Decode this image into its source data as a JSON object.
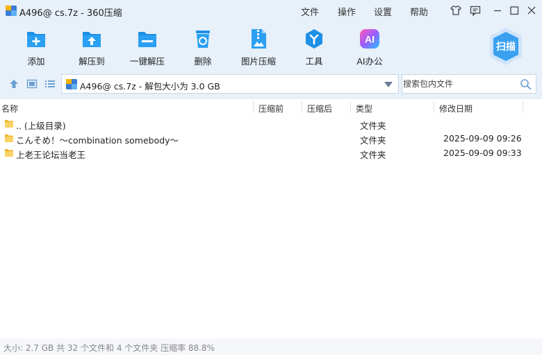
{
  "window": {
    "title": "A496@ cs.7z - 360压缩",
    "menus": [
      "文件",
      "操作",
      "设置",
      "帮助"
    ]
  },
  "toolbar": {
    "items": [
      {
        "label": "添加",
        "icon": "add-folder-icon"
      },
      {
        "label": "解压到",
        "icon": "extract-to-icon"
      },
      {
        "label": "一键解压",
        "icon": "one-click-extract-icon"
      },
      {
        "label": "删除",
        "icon": "recycle-bin-icon"
      },
      {
        "label": "图片压缩",
        "icon": "image-compress-icon"
      },
      {
        "label": "工具",
        "icon": "tools-icon"
      },
      {
        "label": "AI办公",
        "icon": "ai-office-icon"
      }
    ],
    "scan_label": "扫描"
  },
  "nav": {
    "path": "A496@ cs.7z - 解包大小为 3.0 GB",
    "search_placeholder": "搜索包内文件"
  },
  "columns": {
    "name": "名称",
    "packed": "压缩前",
    "compressed": "压缩后",
    "type": "类型",
    "modified": "修改日期"
  },
  "files": [
    {
      "name": ".. (上级目录)",
      "type": "文件夹",
      "modified": ""
    },
    {
      "name": "こんそめ！～combination somebody～",
      "type": "文件夹",
      "modified": "2025-09-09 09:26"
    },
    {
      "name": "上老王论坛当老王",
      "type": "文件夹",
      "modified": "2025-09-09 09:33"
    }
  ],
  "status": "大小: 2.7 GB 共 32 个文件和 4 个文件夹 压缩率 88.8%",
  "colors": {
    "accent": "#1e90e6",
    "toolbar_bg": "#e8f0fa",
    "folder": "#f5c842"
  }
}
